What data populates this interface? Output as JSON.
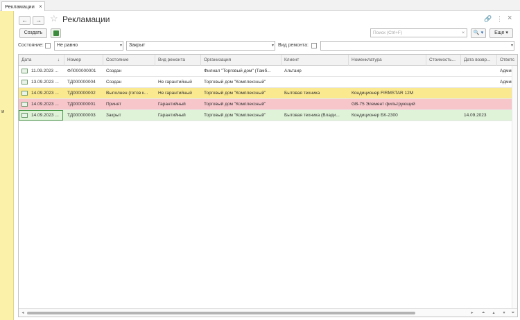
{
  "tab": {
    "label": "Рекламации",
    "close": "×"
  },
  "left_panel_text": "т и",
  "window": {
    "title": "Рекламации",
    "back": "←",
    "forward": "→",
    "star": "☆",
    "link": "🔗",
    "menu": "⋮",
    "close": "×"
  },
  "toolbar": {
    "create_label": "Создать",
    "search_placeholder": "Поиск (Ctrl+F)",
    "search_btn": "🔍 ▾",
    "more_label": "Еще ▾"
  },
  "filters": {
    "state_label": "Состояние:",
    "condition": "Не равно",
    "value": "Закрыт",
    "repair_label": "Вид ремонта:"
  },
  "table": {
    "columns": [
      "Дата",
      "Номер",
      "Состояние",
      "Вид ремонта",
      "Организация",
      "Клиент",
      "Номенклатура",
      "Стоимость...",
      "Дата возвр...",
      "Ответс"
    ],
    "sort_indicator": "↓",
    "rows": [
      {
        "date": "11.09.2023 ...",
        "number": "ФЛ000000001",
        "state": "Создан",
        "repair": "",
        "org": "Филиал \"Торговый дом\" (Тамб...",
        "client": "Альтаир",
        "item": "",
        "cost": "",
        "return": "",
        "resp": "Админ"
      },
      {
        "date": "13.09.2023 ...",
        "number": "ТД000000004",
        "state": "Создан",
        "repair": "Не гарантийный",
        "org": "Торговый дом \"Комплексный\"",
        "client": "",
        "item": "",
        "cost": "",
        "return": "",
        "resp": "Админ"
      },
      {
        "date": "14.09.2023 ...",
        "number": "ТД000000002",
        "state": "Выполнен (готов к...",
        "repair": "Не гарантийный",
        "org": "Торговый дом \"Комплексный\"",
        "client": "Бытовая техника",
        "item": "Кондиционер FIRMSTAR 12M",
        "cost": "",
        "return": "",
        "resp": ""
      },
      {
        "date": "14.09.2023 ...",
        "number": "ТД000000001",
        "state": "Принят",
        "repair": "Гарантийный",
        "org": "Торговый дом \"Комплексный\"",
        "client": "",
        "item": "GB-75 Элемент фильтрующий",
        "cost": "",
        "return": "",
        "resp": ""
      },
      {
        "date": "14.09.2023 ...",
        "number": "ТД000000003",
        "state": "Закрыт",
        "repair": "Гарантийный",
        "org": "Торговый дом \"Комплексный\"",
        "client": "Бытовая техника (Влади...",
        "item": "Кондиционер БК-2300",
        "cost": "",
        "return": "14.09.2023",
        "resp": ""
      }
    ],
    "row_colors": [
      "#ffffff",
      "#ffffff",
      "#fbe98f",
      "#f7c6cb",
      "#dff3d8"
    ]
  }
}
